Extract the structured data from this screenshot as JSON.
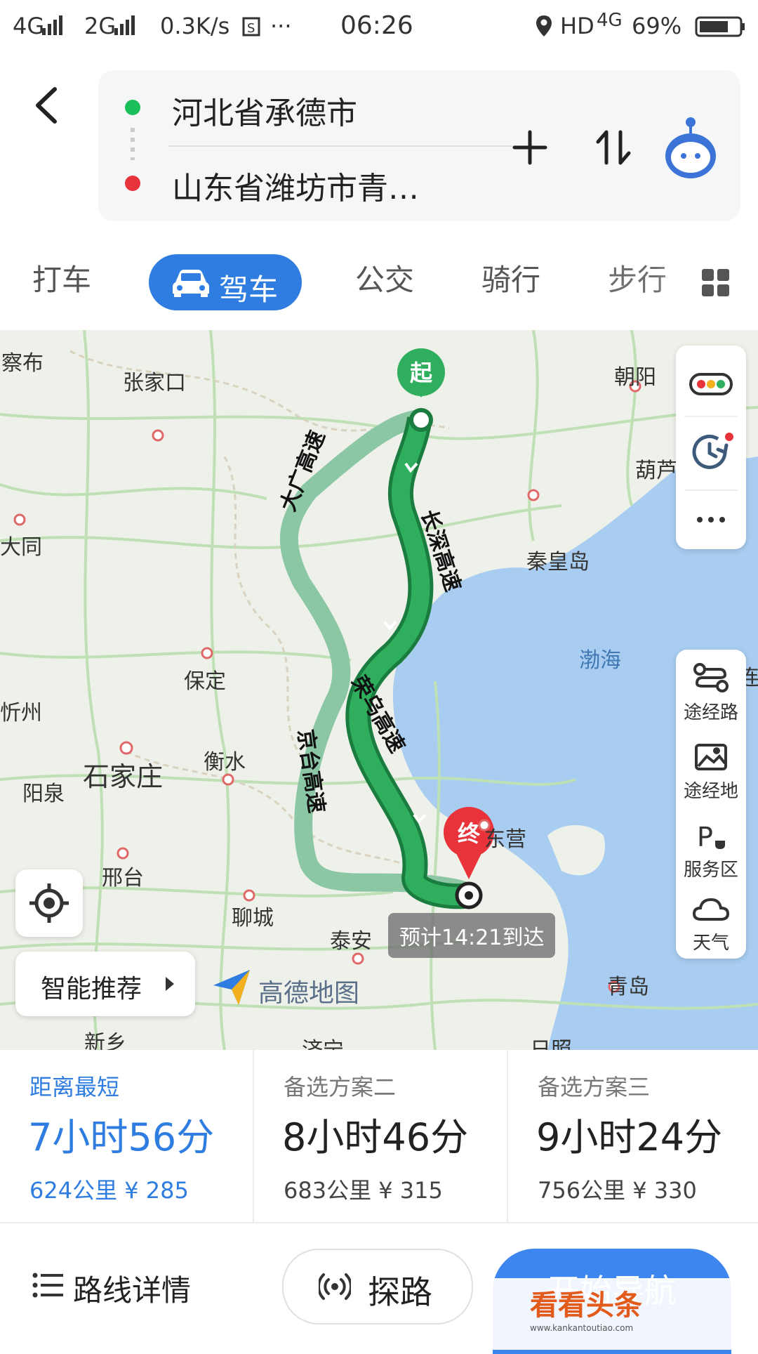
{
  "status_bar": {
    "network1": "4G",
    "network2": "2G",
    "speed": "0.3K/s",
    "more": "···",
    "time": "06:26",
    "hd": "HD",
    "network3": "4G",
    "battery": "69%"
  },
  "route": {
    "origin": "河北省承德市",
    "destination": "山东省潍坊市青…",
    "origin_color": "#1bbf5a",
    "destination_color": "#e8333b"
  },
  "tabs": [
    {
      "label": "打车"
    },
    {
      "label": "驾车",
      "active": true
    },
    {
      "label": "公交"
    },
    {
      "label": "骑行"
    },
    {
      "label": "步行"
    }
  ],
  "map": {
    "cities": [
      "察布",
      "张家口",
      "大同",
      "朝阳",
      "葫芦",
      "秦皇岛",
      "渤海",
      "保定",
      "忻州",
      "石家庄",
      "衡水",
      "阳泉",
      "邢台",
      "聊城",
      "泰安",
      "新乡",
      "青岛",
      "东营",
      "济宁",
      "日照",
      "连"
    ],
    "road_labels": [
      "大广高速",
      "长深高速",
      "荣乌高速",
      "京台高速"
    ],
    "start_marker": "起",
    "end_marker": "终",
    "eta": "预计14:21到达",
    "recommend": "智能推荐",
    "brand": "高德地图",
    "tools": [
      {
        "label": "途经路",
        "icon": "route-waypoint-icon"
      },
      {
        "label": "途经地",
        "icon": "map-pin-icon"
      },
      {
        "label": "服务区",
        "icon": "service-area-icon"
      },
      {
        "label": "天气",
        "icon": "cloud-icon"
      }
    ],
    "traffic_icon": "traffic-light-icon",
    "history_icon": "clock-history-icon",
    "more_icon": "more-icon",
    "route_color": "#1f9a4e",
    "alt_route_color": "#8cc7a5",
    "sea_color": "#a8cdf0"
  },
  "options": [
    {
      "label": "距离最短",
      "time": "7小时56分",
      "distance": "624公里",
      "cost": "¥ 285",
      "selected": true
    },
    {
      "label": "备选方案二",
      "time": "8小时46分",
      "distance": "683公里",
      "cost": "¥ 315"
    },
    {
      "label": "备选方案三",
      "time": "9小时24分",
      "distance": "756公里",
      "cost": "¥ 330"
    }
  ],
  "bottom": {
    "details": "路线详情",
    "explore": "探路",
    "start_nav": "开始导航",
    "watermark": "看看头条",
    "watermark_url": "www.kankantoutiao.com"
  },
  "accent_color": "#2f7de1"
}
